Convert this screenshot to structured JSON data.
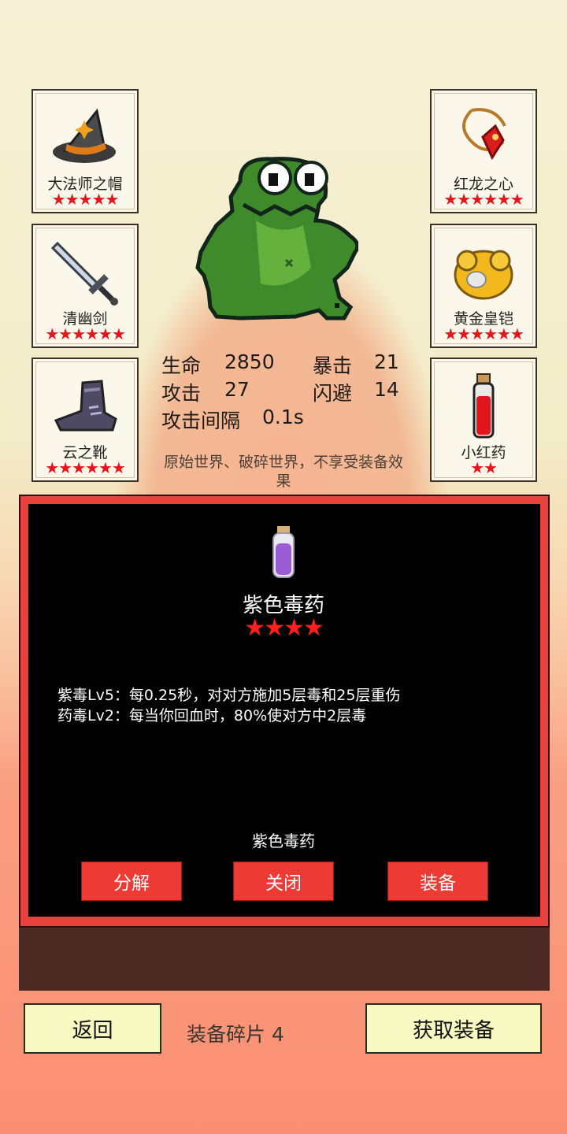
{
  "equipment_left": [
    {
      "name": "大法师之帽",
      "stars": "★★★★★",
      "icon": "wizard-hat-icon"
    },
    {
      "name": "清幽剑",
      "stars": "★★★★★★",
      "icon": "sword-icon"
    },
    {
      "name": "云之靴",
      "stars": "★★★★★★",
      "icon": "boot-icon"
    }
  ],
  "equipment_right": [
    {
      "name": "红龙之心",
      "stars": "★★★★★★",
      "icon": "red-amulet-icon"
    },
    {
      "name": "黄金皇铠",
      "stars": "★★★★★★",
      "icon": "gold-armor-icon"
    },
    {
      "name": "小红药",
      "stars": "★★",
      "icon": "red-potion-icon"
    }
  ],
  "stats": {
    "hp_label": "生命",
    "hp_value": "2850",
    "crit_label": "暴击",
    "crit_value": "21",
    "atk_label": "攻击",
    "atk_value": "27",
    "dodge_label": "闪避",
    "dodge_value": "14",
    "interval_label": "攻击间隔",
    "interval_value": "0.1s"
  },
  "note": "原始世界、破碎世界，不享受装备效果",
  "dialog": {
    "item_name": "紫色毒药",
    "item_stars": "★★★★",
    "effect_1": "紫毒Lv5：每0.25秒，对对方施加5层毒和25层重伤",
    "effect_2": "药毒Lv2：每当你回血时，80%使对方中2层毒",
    "sub_name": "紫色毒药",
    "btn_decompose": "分解",
    "btn_close": "关闭",
    "btn_equip": "装备"
  },
  "footer": {
    "back_label": "返回",
    "fragments_text": "装备碎片 4",
    "get_equipment_label": "获取装备"
  },
  "colors": {
    "accent_red": "#e8423c",
    "star_red": "#e8141c",
    "button_yellow": "#f8f8c3"
  }
}
